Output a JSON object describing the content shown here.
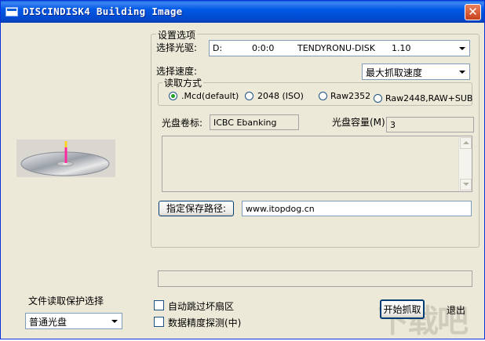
{
  "window": {
    "title": "DISCINDISK4 Building Image",
    "close_glyph": "✕"
  },
  "settings_group": {
    "label": "设置选项"
  },
  "drive": {
    "label": "选择光驱:",
    "letter": "D:",
    "address": "0:0:0",
    "vendor": "TENDYRONU-DISK",
    "version": "1.10"
  },
  "speed": {
    "label": "选择速度:",
    "selected": "最大抓取速度"
  },
  "read_mode": {
    "label": "读取方式",
    "options": [
      ".Mcd(default)",
      "2048 (ISO)",
      "Raw2352",
      "Raw2448,RAW+SUB"
    ],
    "selected_index": 0
  },
  "volume": {
    "label": "光盘卷标:",
    "value": "ICBC Ebanking"
  },
  "capacity": {
    "label": "光盘容量(M):",
    "value": "3"
  },
  "save_path": {
    "button_label": "指定保存路径:",
    "value": "www.itopdog.cn"
  },
  "protection": {
    "label": "文件读取保护选择",
    "selected": "普通光盘"
  },
  "options": {
    "skip_bad_sectors": "自动跳过坏扇区",
    "precision_detect": "数据精度探测(中)"
  },
  "actions": {
    "start": "开始抓取",
    "exit": "退出"
  },
  "watermark": "下载吧"
}
